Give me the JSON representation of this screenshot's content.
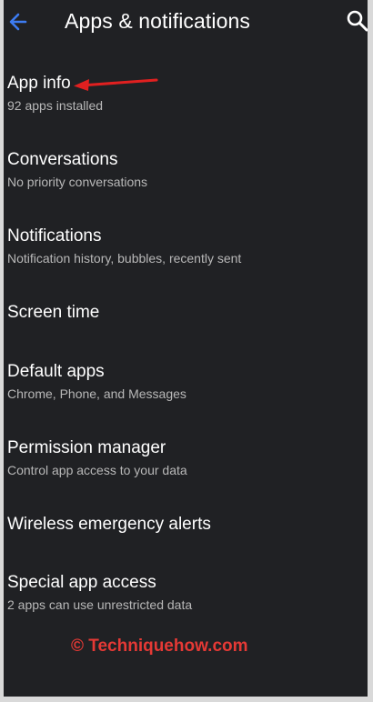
{
  "header": {
    "title": "Apps & notifications",
    "back_icon": "arrow-left-icon",
    "search_icon": "search-icon",
    "accent_color": "#3d7cf2"
  },
  "items": [
    {
      "label": "App info",
      "sub": "92 apps installed"
    },
    {
      "label": "Conversations",
      "sub": "No priority conversations"
    },
    {
      "label": "Notifications",
      "sub": "Notification history, bubbles, recently sent"
    },
    {
      "label": "Screen time",
      "sub": ""
    },
    {
      "label": "Default apps",
      "sub": "Chrome, Phone, and Messages"
    },
    {
      "label": "Permission manager",
      "sub": "Control app access to your data"
    },
    {
      "label": "Wireless emergency alerts",
      "sub": ""
    },
    {
      "label": "Special app access",
      "sub": "2 apps can use unrestricted data"
    }
  ],
  "annotation": {
    "arrow_color": "#e02020"
  },
  "watermark": {
    "text": "© Techniquehow.com",
    "color": "#e53935"
  }
}
